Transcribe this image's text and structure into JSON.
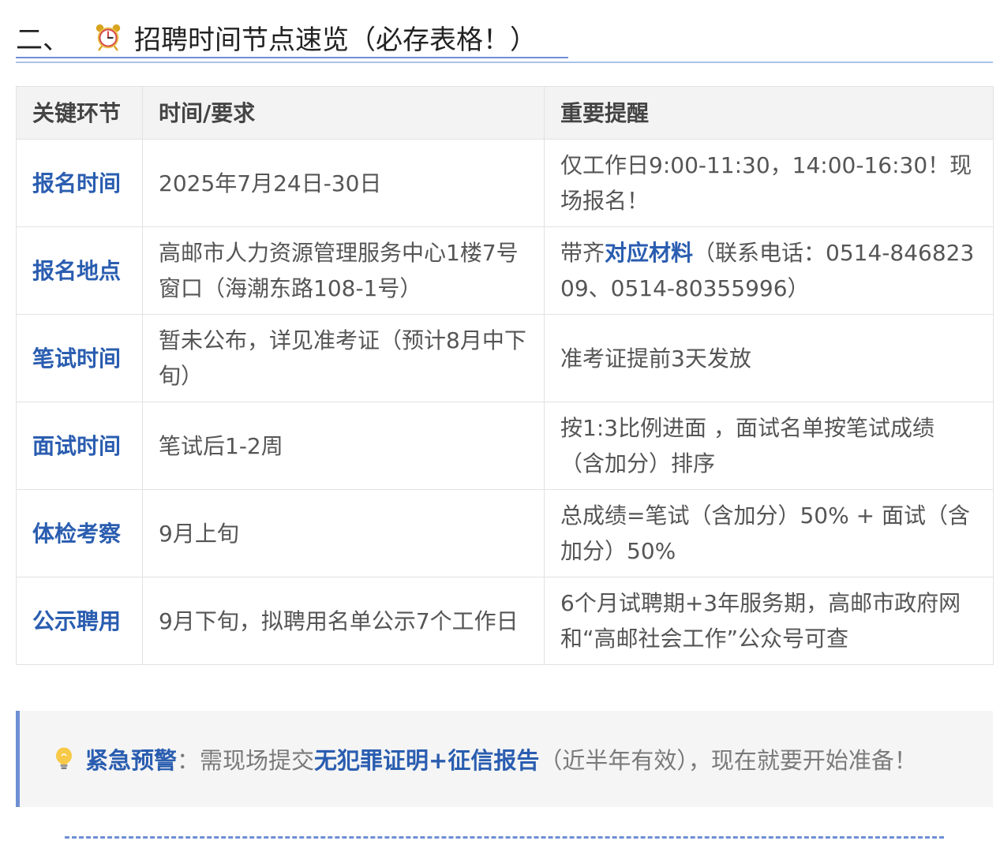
{
  "heading": {
    "prefix": "二、",
    "icon": "alarm-clock-icon",
    "title": "招聘时间节点速览（必存表格！）"
  },
  "table": {
    "headers": [
      "关键环节",
      "时间/要求",
      "重要提醒"
    ],
    "rows": [
      {
        "stage": "报名时间",
        "time": "2025年7月24日-30日",
        "note": "仅工作日9:00-11:30，14:00-16:30！现场报名！"
      },
      {
        "stage": "报名地点",
        "time": "高邮市人力资源管理服务中心1楼7号窗口（海潮东路108-1号）",
        "note_prefix": "带齐",
        "note_highlight": "对应材料",
        "note_suffix": "（联系电话：0514-84682309、0514-80355996）"
      },
      {
        "stage": "笔试时间",
        "time": "暂未公布，详见准考证（预计8月中下旬）",
        "note": "准考证提前3天发放"
      },
      {
        "stage": "面试时间",
        "time": "笔试后1-2周",
        "note": "按1:3比例进面 ，面试名单按笔试成绩（含加分）排序"
      },
      {
        "stage": "体检考察",
        "time": "9月上旬",
        "note": "总成绩=笔试（含加分）50% + 面试（含加分）50%"
      },
      {
        "stage": "公示聘用",
        "time": "9月下旬，拟聘用名单公示7个工作日",
        "note": "6个月试聘期+3年服务期，高邮市政府网和“高邮社会工作”公众号可查"
      }
    ]
  },
  "callout": {
    "icon": "lightbulb-icon",
    "title": "紧急预警",
    "colon": "：",
    "text_before": "需现场提交",
    "highlight": "无犯罪证明+征信报告",
    "text_after": "（近半年有效），现在就要开始准备！"
  },
  "colors": {
    "accent": "#2a5db0",
    "rule": "#6e8fd4",
    "header_bg": "#f3f3f3",
    "callout_bg": "#f5f5f5"
  }
}
